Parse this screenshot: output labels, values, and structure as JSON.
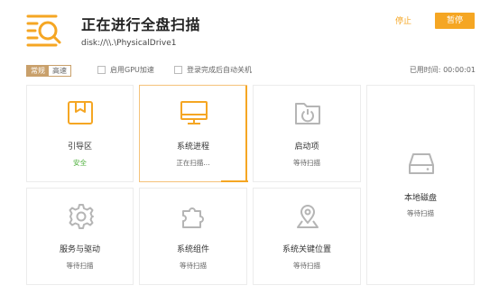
{
  "header": {
    "title": "正在进行全盘扫描",
    "path": "disk://\\\\.\\PhysicalDrive1",
    "stop_label": "停止",
    "pause_label": "暂停",
    "accent_color": "#f5a623"
  },
  "options": {
    "modes": [
      "常规",
      "高速"
    ],
    "selected_mode": "常规",
    "gpu_label": "启用GPU加速",
    "gpu_checked": false,
    "shutdown_label": "登录完成后自动关机",
    "shutdown_checked": false,
    "elapsed_label": "已用时间:",
    "elapsed_value": "00:00:01"
  },
  "tiles": [
    {
      "name": "引导区",
      "status": "安全",
      "icon": "bookmark-icon"
    },
    {
      "name": "系统进程",
      "status": "正在扫描...",
      "icon": "monitor-icon"
    },
    {
      "name": "启动项",
      "status": "等待扫描",
      "icon": "power-folder-icon"
    },
    {
      "name": "本地磁盘",
      "status": "等待扫描",
      "icon": "hard-disk-icon"
    },
    {
      "name": "服务与驱动",
      "status": "等待扫描",
      "icon": "gear-icon"
    },
    {
      "name": "系统组件",
      "status": "等待扫描",
      "icon": "puzzle-icon"
    },
    {
      "name": "系统关键位置",
      "status": "等待扫描",
      "icon": "location-pin-icon"
    }
  ]
}
